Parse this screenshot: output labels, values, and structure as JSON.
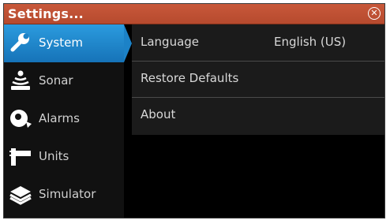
{
  "window": {
    "title": "Settings..."
  },
  "sidebar": {
    "items": [
      {
        "label": "System",
        "icon": "wrench-icon",
        "active": true
      },
      {
        "label": "Sonar",
        "icon": "sonar-icon"
      },
      {
        "label": "Alarms",
        "icon": "alarm-icon"
      },
      {
        "label": "Units",
        "icon": "units-icon"
      },
      {
        "label": "Simulator",
        "icon": "simulator-icon"
      }
    ]
  },
  "system": {
    "rows": [
      {
        "label": "Language",
        "value": "English (US)"
      },
      {
        "label": "Restore Defaults"
      },
      {
        "label": "About"
      }
    ]
  },
  "colors": {
    "titlebar": "#b84c30",
    "active_item": "#1d82c9",
    "content_bg": "#1b1b1b",
    "sidebar_bg": "#111111"
  }
}
